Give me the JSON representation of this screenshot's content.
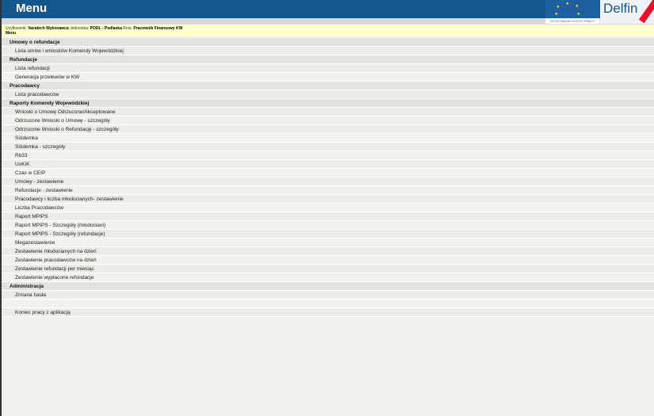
{
  "header": {
    "title": "Menu",
    "eu_caption": "OCHOTNICZE HUFCE PRACY",
    "logo_text": "Delfin"
  },
  "info": {
    "user_label": "Użytkownik:",
    "user": "Vavatech Wykonawca",
    "unit_label": "Jednostka:",
    "unit": "PODL - Podlaska",
    "role_label": "Rola:",
    "role": "Pracownik Finansowy KW",
    "crumb": "Menu"
  },
  "sections": [
    {
      "title": "Umowy o refundacje",
      "items": [
        "Lista umów i wniosków Komendy Wojewódzkiej"
      ]
    },
    {
      "title": "Refundacje",
      "items": [
        "Lista refundacji",
        "Generacja przelewów w KW"
      ]
    },
    {
      "title": "Pracodawcy",
      "items": [
        "Lista pracodawców"
      ]
    },
    {
      "title": "Raporty Komendy Wojewódzkiej",
      "items": [
        "Wnioski o Umowę Odrzucone/Akceptowane",
        "Odrzucone Wnioski o Umowę - szczegóły",
        "Odrzucone Wnioski o Refundację - szczegóły",
        "Siódemka",
        "Siódemka - szczegóły",
        "Rb33",
        "UoKiK",
        "Czas w CEIP",
        "Umowy - zestawienie",
        "Refundacje - zestawienie",
        "Pracodawcy i liczba młodocianych- zestawienie",
        "Liczba Pracodawców",
        "Raport MPIPS",
        "Raport MPIPS - Szczegóły (młodociani)",
        "Raport MPIPS - Szczegóły (refundacje)",
        "Megazestawienie",
        "Zestawienie młodocianych na dzień",
        "Zestawienie pracodawców na dzień",
        "Zestawienie refundacji per miesiąc",
        "Zestawienie wypłacone refundacje"
      ]
    },
    {
      "title": "Administracja",
      "items": [
        "Zmiana hasła",
        "",
        "Koniec pracy z aplikacją"
      ]
    }
  ]
}
